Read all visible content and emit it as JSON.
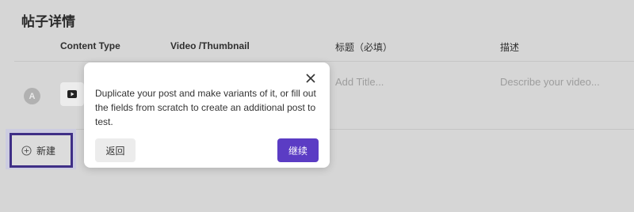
{
  "page": {
    "title": "帖子详情"
  },
  "table": {
    "headers": {
      "content_type": "Content Type",
      "video_thumbnail": "Video /Thumbnail",
      "title": "标题（必填）",
      "description": "描述"
    },
    "row": {
      "avatar_letter": "A",
      "content_type_icon": "youtube-icon",
      "title_placeholder": "Add Title...",
      "description_placeholder": "Describe your video..."
    }
  },
  "new_button": {
    "icon": "plus-circle-icon",
    "label": "新建"
  },
  "popover": {
    "message": "Duplicate your post and make variants of it, or fill out the fields from scratch to create an additional post to test.",
    "back_label": "返回",
    "continue_label": "继续",
    "close_icon": "close-icon"
  },
  "colors": {
    "accent": "#5b3cc4",
    "highlight_border": "#3f2f86",
    "overlay": "#d6d6d6"
  }
}
